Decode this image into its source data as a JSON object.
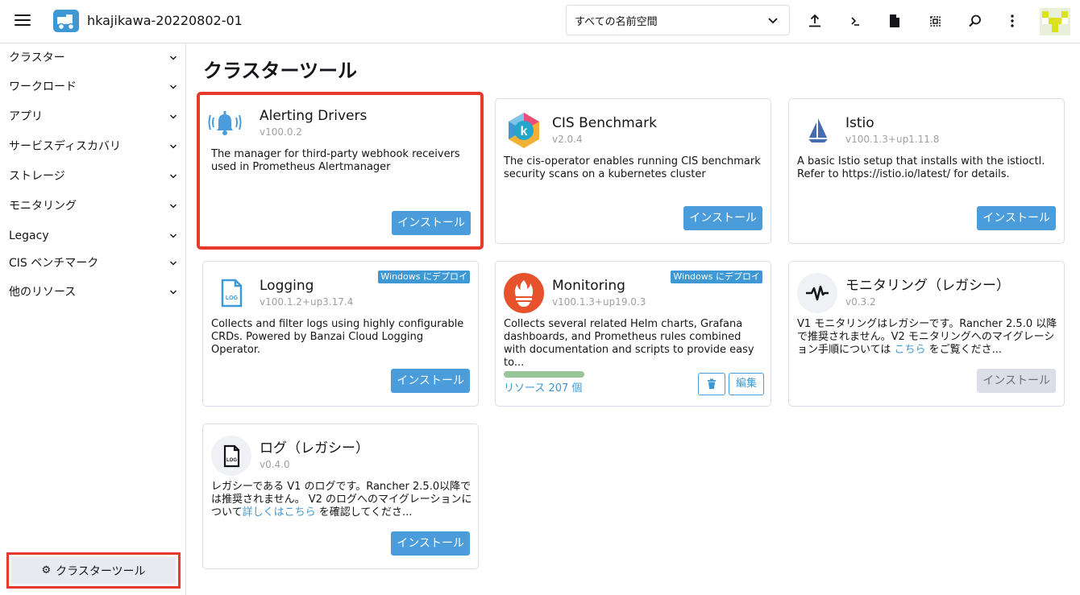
{
  "header": {
    "cluster_name": "hkajikawa-20220802-01",
    "namespace_selected": "すべての名前空間",
    "icons": [
      "upload-icon",
      "shell-icon",
      "file-icon",
      "copy-icon",
      "search-icon",
      "more-icon"
    ]
  },
  "sidebar": {
    "items": [
      {
        "label": "クラスター"
      },
      {
        "label": "ワークロード"
      },
      {
        "label": "アプリ"
      },
      {
        "label": "サービスディスカバリ"
      },
      {
        "label": "ストレージ"
      },
      {
        "label": "モニタリング"
      },
      {
        "label": "Legacy"
      },
      {
        "label": "CIS ベンチマーク"
      },
      {
        "label": "他のリソース"
      }
    ],
    "tools_button": "クラスターツール"
  },
  "main": {
    "title": "クラスターツール",
    "cards": [
      {
        "name": "Alerting Drivers",
        "version": "v100.0.2",
        "desc": "The manager for third-party webhook receivers used in Prometheus Alertmanager",
        "install": "インストール"
      },
      {
        "name": "CIS Benchmark",
        "version": "v2.0.4",
        "desc": "The cis-operator enables running CIS benchmark security scans on a kubernetes cluster",
        "install": "インストール"
      },
      {
        "name": "Istio",
        "version": "v100.1.3+up1.11.8",
        "desc": "A basic Istio setup that installs with the istioctl. Refer to https://istio.io/latest/ for details.",
        "install": "インストール"
      },
      {
        "name": "Logging",
        "version": "v100.1.2+up3.17.4",
        "desc": "Collects and filter logs using highly configurable CRDs. Powered by Banzai Cloud Logging Operator.",
        "install": "インストール",
        "badge": "Windows にデプロイ"
      },
      {
        "name": "Monitoring",
        "version": "v100.1.3+up19.0.3",
        "desc": "Collects several related Helm charts, Grafana dashboards, and Prometheus rules combined with documentation and scripts to provide easy to...",
        "badge": "Windows にデプロイ",
        "resources": "リソース 207 個",
        "progress": 1.0,
        "edit": "編集"
      },
      {
        "name": "モニタリング（レガシー）",
        "version": "v0.3.2",
        "desc_before": "V1 モニタリングはレガシーです。Rancher 2.5.0 以降で推奨されません。V2 モニタリングへのマイグレーション手順については ",
        "desc_link": "こちら",
        "desc_after": " をご覧くださ...",
        "install": "インストール"
      },
      {
        "name": "ログ（レガシー）",
        "version": "v0.4.0",
        "desc_before": "レガシーである V1 のログです。Rancher 2.5.0以降では推奨されません。 V2 のログへのマイグレーションについて",
        "desc_link": "詳しくはこちら",
        "desc_after": " を確認してくださ...",
        "install": "インストール"
      }
    ]
  },
  "colors": {
    "accent": "#3d98d3",
    "button": "#4a9cdb",
    "highlight": "#e8392d",
    "progress": "#97c597"
  }
}
